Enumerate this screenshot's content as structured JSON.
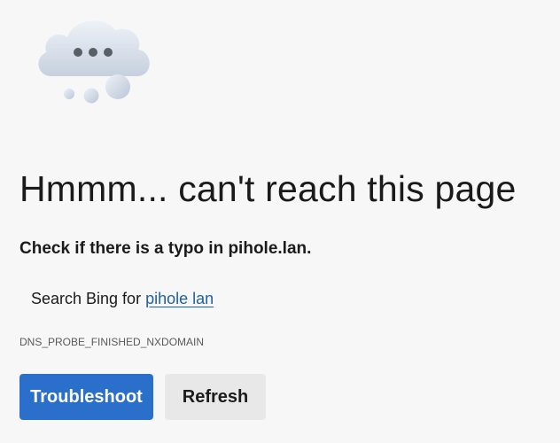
{
  "error_page": {
    "illustration_icon": "cloud-with-dots-icon",
    "heading": "Hmmm... can't reach this page",
    "typo_hint": "Check if there is a typo in pihole.lan.",
    "search_prefix": "Search Bing for ",
    "search_link": "pihole lan",
    "error_code": "DNS_PROBE_FINISHED_NXDOMAIN"
  },
  "buttons": {
    "troubleshoot_label": "Troubleshoot",
    "refresh_label": "Refresh"
  },
  "colors": {
    "background": "#f7f7f7",
    "primary_button": "#2a6fc9",
    "secondary_button": "#e8e8e8",
    "link": "#1d5fa8"
  }
}
